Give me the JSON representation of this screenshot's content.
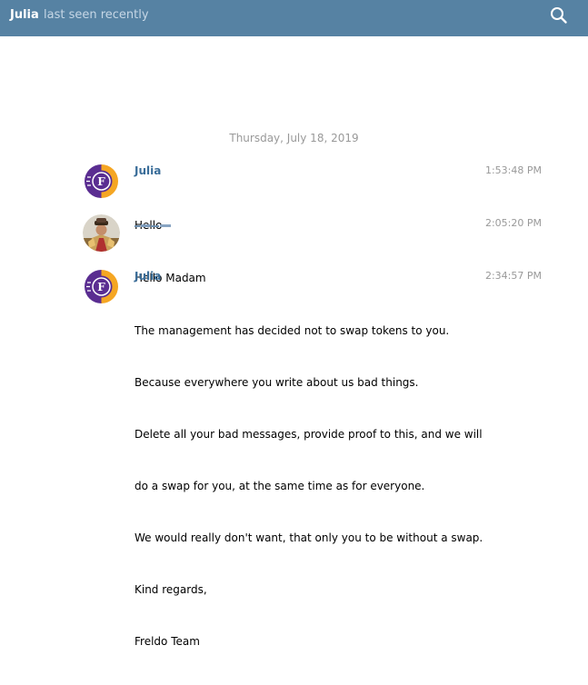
{
  "header": {
    "name": "Julia",
    "status": "last seen recently",
    "search_icon": "search-icon"
  },
  "date_separator": "Thursday, July 18, 2019",
  "messages": [
    {
      "sender": "Julia",
      "time": "1:53:48 PM",
      "lines": [
        "Hello"
      ]
    },
    {
      "sender": "",
      "time": "2:05:20 PM",
      "lines": [
        "Hello Madam"
      ]
    },
    {
      "sender": "Julia",
      "time": "2:34:57 PM",
      "lines": [
        "The management has decided not to swap tokens to you.",
        "Because everywhere you write about us bad things.",
        "Delete all your bad messages, provide proof to this, and we will",
        "do a swap for you, at the same time as for everyone.",
        "We would really don't want, that only you to be without a swap.",
        "Kind regards,",
        "Freldo Team"
      ]
    }
  ],
  "colors": {
    "header_bg": "#5682a3",
    "sender_name": "#3a6d99",
    "timestamp": "#999999"
  }
}
